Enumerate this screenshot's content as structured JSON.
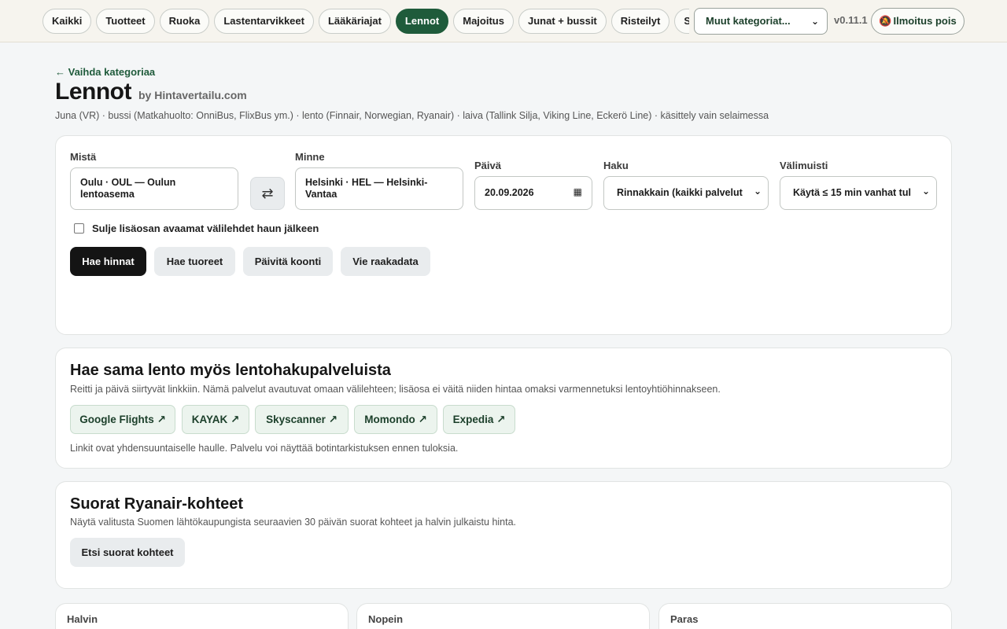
{
  "topbar": {
    "tabs": [
      {
        "label": "Kaikki"
      },
      {
        "label": "Tuotteet"
      },
      {
        "label": "Ruoka"
      },
      {
        "label": "Lastentarvikkeet"
      },
      {
        "label": "Lääkäriajat"
      },
      {
        "label": "Lennot",
        "active": true
      },
      {
        "label": "Majoitus"
      },
      {
        "label": "Junat + bussit"
      },
      {
        "label": "Risteilyt"
      },
      {
        "label": "Sähk"
      }
    ],
    "category_select": "Muut kategoriat...",
    "version": "v0.11.1",
    "notify_label": "Ilmoitus pois",
    "accent_color": "#1f5b3b"
  },
  "header": {
    "back_link": "← Vaihda kategoriaa",
    "title": "Lennot",
    "by": "by Hintavertailu.com",
    "subtitle": "Juna (VR) · bussi (Matkahuolto: OnniBus, FlixBus ym.) · lento (Finnair, Norwegian, Ryanair) · laiva (Tallink Silja, Viking Line, Eckerö Line) · käsittely vain selaimessa"
  },
  "search": {
    "from_label": "Mistä",
    "from_value": "Oulu · OUL — Oulun lentoasema",
    "to_label": "Minne",
    "to_value": "Helsinki · HEL — Helsinki-Vantaa",
    "date_label": "Päivä",
    "date_value": "20.09.2026",
    "mode_label": "Haku",
    "mode_value": "Rinnakkain (kaikki palvelut",
    "cache_label": "Välimuisti",
    "cache_value": "Käytä ≤ 15 min vanhat tul",
    "close_tabs_label": "Sulje lisäosan avaamat välilehdet haun jälkeen",
    "buttons": {
      "search": "Hae hinnat",
      "fresh": "Hae tuoreet",
      "refresh": "Päivitä koonti",
      "export": "Vie raakadata"
    }
  },
  "external": {
    "title": "Hae sama lento myös lentohakupalveluista",
    "desc": "Reitti ja päivä siirtyvät linkkiin. Nämä palvelut avautuvat omaan välilehteen; lisäosa ei väitä niiden hintaa omaksi varmennetuksi lentoyhtiöhinnakseen.",
    "links": [
      {
        "label": "Google Flights ↗"
      },
      {
        "label": "KAYAK ↗"
      },
      {
        "label": "Skyscanner ↗"
      },
      {
        "label": "Momondo ↗"
      },
      {
        "label": "Expedia ↗"
      }
    ],
    "note": "Linkit ovat yhdensuuntaiselle haulle. Palvelu voi näyttää botintarkistuksen ennen tuloksia."
  },
  "ryanair": {
    "title": "Suorat Ryanair-kohteet",
    "desc": "Näytä valitusta Suomen lähtökaupungista seuraavien 30 päivän suorat kohteet ja halvin julkaistu hinta.",
    "button": "Etsi suorat kohteet"
  },
  "summary": {
    "cheapest": "Halvin",
    "fastest": "Nopein",
    "best": "Paras"
  }
}
